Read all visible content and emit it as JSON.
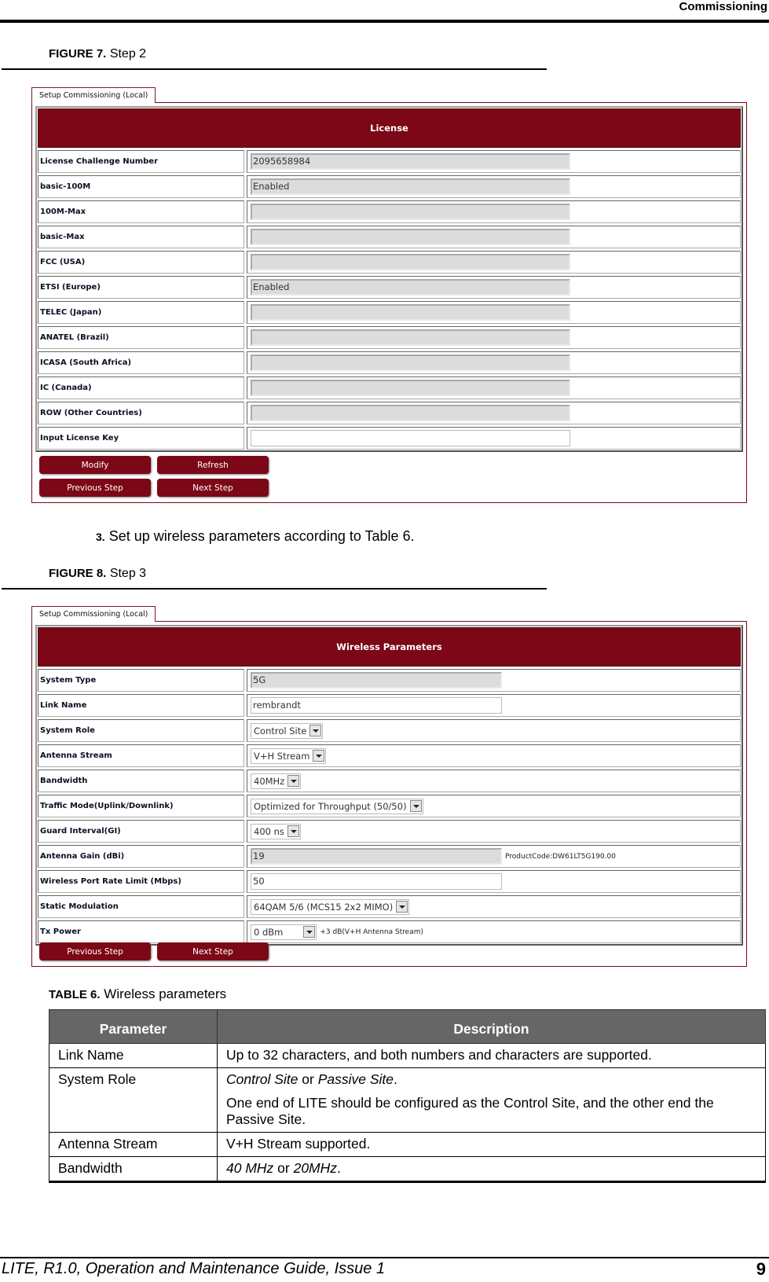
{
  "header": {
    "section": "Commissioning"
  },
  "figure7": {
    "label": "FIGURE 7.",
    "title": "Step 2",
    "tab": "Setup Commissioning (Local)",
    "banner": "License",
    "rows": [
      {
        "label": "License Challenge Number",
        "value": "2095658984",
        "type": "readonly"
      },
      {
        "label": "basic-100M",
        "value": "Enabled",
        "type": "readonly"
      },
      {
        "label": "100M-Max",
        "value": "",
        "type": "readonly"
      },
      {
        "label": "basic-Max",
        "value": "",
        "type": "readonly"
      },
      {
        "label": "FCC (USA)",
        "value": "",
        "type": "readonly"
      },
      {
        "label": "ETSI (Europe)",
        "value": "Enabled",
        "type": "readonly"
      },
      {
        "label": "TELEC (Japan)",
        "value": "",
        "type": "readonly"
      },
      {
        "label": "ANATEL (Brazil)",
        "value": "",
        "type": "readonly"
      },
      {
        "label": "ICASA (South Africa)",
        "value": "",
        "type": "readonly"
      },
      {
        "label": "IC (Canada)",
        "value": "",
        "type": "readonly"
      },
      {
        "label": "ROW (Other Countries)",
        "value": "",
        "type": "readonly"
      },
      {
        "label": "Input License Key",
        "value": "",
        "type": "input"
      }
    ],
    "buttons": {
      "modify": "Modify",
      "refresh": "Refresh",
      "previous": "Previous Step",
      "next": "Next Step"
    }
  },
  "step3": {
    "num": "3.",
    "text": "Set up wireless parameters according to Table 6."
  },
  "figure8": {
    "label": "FIGURE 8.",
    "title": "Step 3",
    "tab": "Setup Commissioning (Local)",
    "banner": "Wireless Parameters",
    "rows": [
      {
        "label": "System Type",
        "value": "5G",
        "type": "readonly"
      },
      {
        "label": "Link Name",
        "value": "rembrandt",
        "type": "input"
      },
      {
        "label": "System Role",
        "value": "Control Site",
        "type": "select"
      },
      {
        "label": "Antenna Stream",
        "value": "V+H Stream",
        "type": "select"
      },
      {
        "label": "Bandwidth",
        "value": "40MHz",
        "type": "select"
      },
      {
        "label": "Traffic Mode(Uplink/Downlink)",
        "value": "Optimized for Throughput (50/50)",
        "type": "select"
      },
      {
        "label": "Guard Interval(GI)",
        "value": "400 ns",
        "type": "select"
      },
      {
        "label": "Antenna Gain (dBi)",
        "value": "19",
        "type": "readonly",
        "note": "ProductCode:DW61LT5G190.00"
      },
      {
        "label": "Wireless Port Rate Limit (Mbps)",
        "value": "50",
        "type": "input"
      },
      {
        "label": "Static Modulation",
        "value": "64QAM 5/6 (MCS15 2x2 MIMO)",
        "type": "select"
      },
      {
        "label": "Tx Power",
        "value": "0 dBm",
        "type": "select",
        "note": "+3 dB(V+H Antenna Stream)"
      }
    ],
    "buttons": {
      "previous": "Previous Step",
      "next": "Next Step"
    }
  },
  "table6": {
    "label": "TABLE 6.",
    "title": "Wireless parameters",
    "columns": [
      "Parameter",
      "Description"
    ],
    "rows": [
      {
        "param": "Link Name",
        "desc": "Up to 32 characters, and both numbers and characters are supported."
      },
      {
        "param": "System Role",
        "desc_a": "Control Site",
        "desc_or": " or ",
        "desc_b": "Passive Site",
        "desc_end": ".",
        "desc2": "One end of LITE should be configured as the Control Site, and the other end the Passive Site."
      },
      {
        "param": "Antenna Stream",
        "desc": "V+H Stream supported."
      },
      {
        "param": "Bandwidth",
        "desc_a": "40 MHz",
        "desc_or": " or ",
        "desc_b": "20MHz",
        "desc_end": "."
      }
    ]
  },
  "footer": {
    "title": "LITE, R1.0, Operation and Maintenance Guide, Issue 1",
    "page": "9"
  }
}
